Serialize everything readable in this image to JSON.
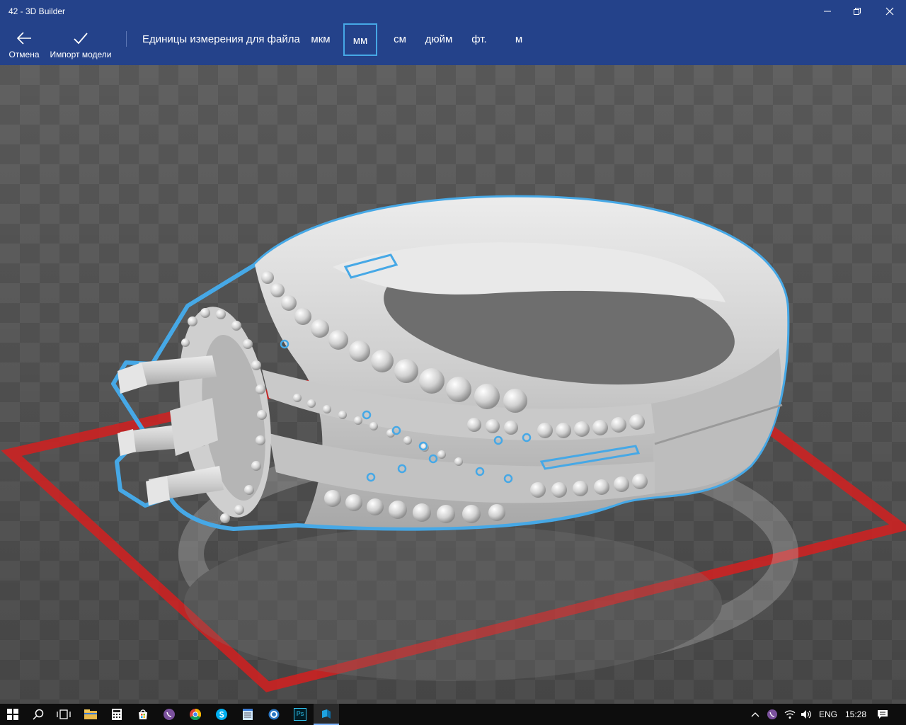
{
  "window": {
    "title": "42 - 3D Builder"
  },
  "toolbar": {
    "cancel_label": "Отмена",
    "import_label": "Импорт модели",
    "units_label": "Единицы измерения для файла",
    "units": [
      {
        "label": "мкм",
        "selected": false
      },
      {
        "label": "мм",
        "selected": true
      },
      {
        "label": "см",
        "selected": false
      },
      {
        "label": "дюйм",
        "selected": false
      },
      {
        "label": "фт.",
        "selected": false
      },
      {
        "label": "м",
        "selected": false
      }
    ]
  },
  "taskbar": {
    "language": "ENG",
    "time": "15:28",
    "apps": [
      "start-icon",
      "search-icon",
      "task-view-icon",
      "file-explorer-icon",
      "calculator-icon",
      "store-icon",
      "viber-icon",
      "chrome-icon",
      "skype-icon",
      "notepad-icon",
      "browser-icon",
      "photoshop-icon",
      "3d-builder-icon"
    ],
    "photoshop_label": "Ps"
  },
  "colors": {
    "titlebar": "#24428a",
    "selection": "#46a8e6",
    "platform_border": "#d32020",
    "model": "#d8d8d8",
    "taskbar": "#0d0d0d"
  }
}
